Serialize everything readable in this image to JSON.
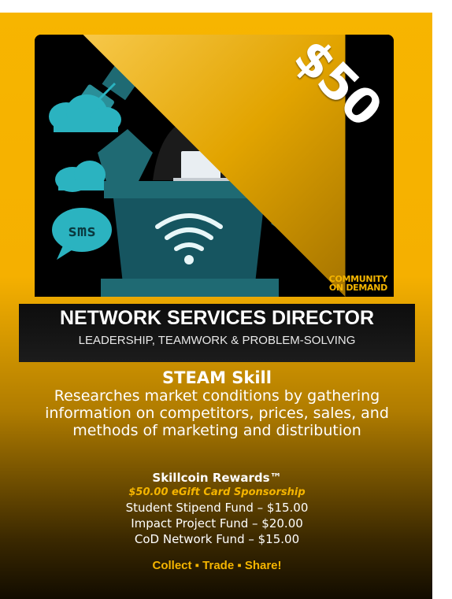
{
  "price": "$50",
  "logo_text": [
    "COMMUNITY",
    "ON DEMAND"
  ],
  "title": "NETWORK SERVICES DIRECTOR",
  "subtitle": "LEADERSHIP, TEAMWORK & PROBLEM-SOLVING",
  "skill": {
    "heading": "STEAM Skill",
    "description": "Researches market conditions by gathering information on competitors, prices, sales, and methods of marketing and distribution"
  },
  "rewards": {
    "heading": "Skillcoin Rewards™",
    "sponsorship": "$50.00 eGift Card Sponsorship",
    "funds": [
      "Student Stipend Fund – $15.00",
      "Impact Project Fund – $20.00",
      "CoD Network Fund – $15.00"
    ]
  },
  "cta": "Collect ▪ Trade ▪ Share!",
  "illustration": {
    "sms_label": "sms",
    "icons": [
      "satellite-icon",
      "cloud-icon",
      "globe-icon",
      "phone-icon",
      "wifi-icon",
      "laptop-icon",
      "sms-bubble-icon"
    ]
  },
  "colors": {
    "gold": "#f5b500",
    "teal": "#2bb3c0",
    "dark": "#0d0d0d"
  }
}
